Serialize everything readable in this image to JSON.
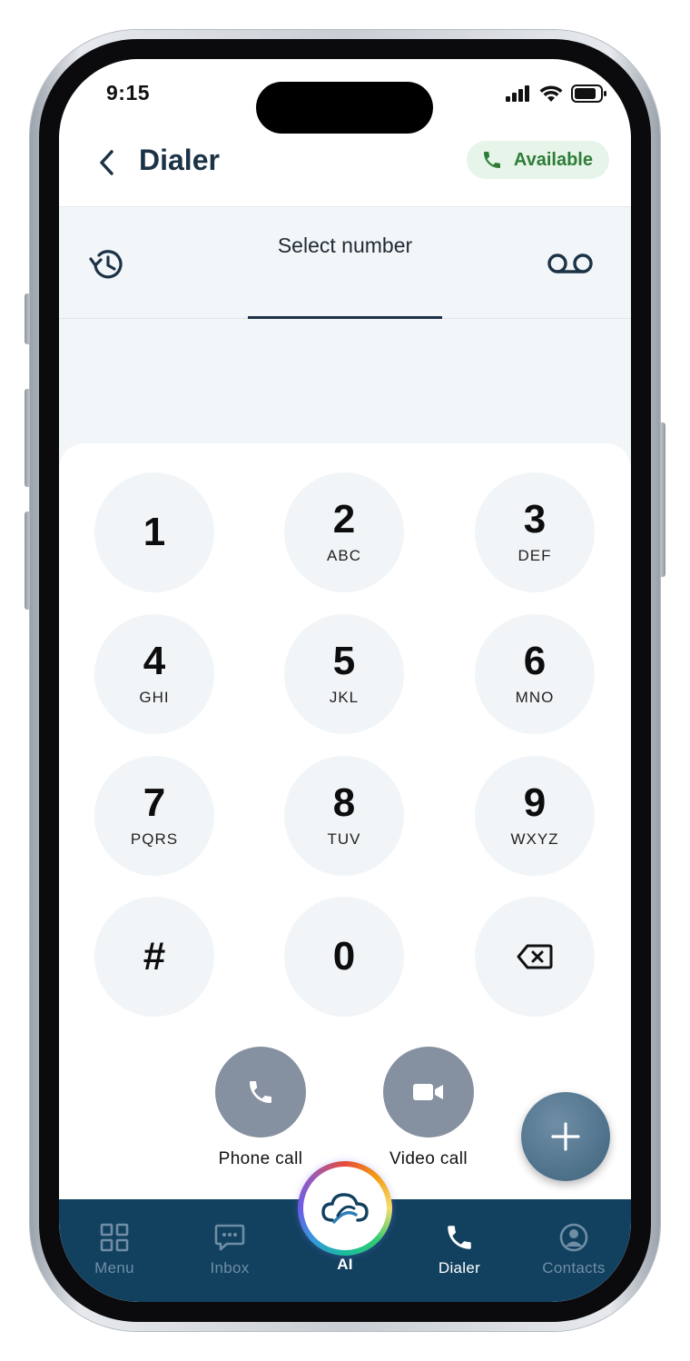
{
  "status_bar": {
    "time": "9:15"
  },
  "header": {
    "title": "Dialer",
    "availability": "Available"
  },
  "number_bar": {
    "select_label": "Select number"
  },
  "keypad": {
    "keys": [
      {
        "digit": "1",
        "letters": ""
      },
      {
        "digit": "2",
        "letters": "ABC"
      },
      {
        "digit": "3",
        "letters": "DEF"
      },
      {
        "digit": "4",
        "letters": "GHI"
      },
      {
        "digit": "5",
        "letters": "JKL"
      },
      {
        "digit": "6",
        "letters": "MNO"
      },
      {
        "digit": "7",
        "letters": "PQRS"
      },
      {
        "digit": "8",
        "letters": "TUV"
      },
      {
        "digit": "9",
        "letters": "WXYZ"
      },
      {
        "digit": "#",
        "letters": ""
      },
      {
        "digit": "0",
        "letters": ""
      }
    ]
  },
  "actions": {
    "phone_call": "Phone call",
    "video_call": "Video call"
  },
  "nav": {
    "items": [
      {
        "label": "Menu",
        "icon": "grid-icon"
      },
      {
        "label": "Inbox",
        "icon": "chat-icon"
      },
      {
        "label": "AI",
        "icon": "cloud-icon"
      },
      {
        "label": "Dialer",
        "icon": "phone-icon"
      },
      {
        "label": "Contacts",
        "icon": "person-icon"
      }
    ],
    "active": "Dialer"
  },
  "colors": {
    "nav_bg": "#12415f",
    "title": "#1c3246",
    "available_bg": "#e7f4ea",
    "available_text": "#2e7d37",
    "call_button": "#8590a0",
    "fab": "#4d7089"
  }
}
